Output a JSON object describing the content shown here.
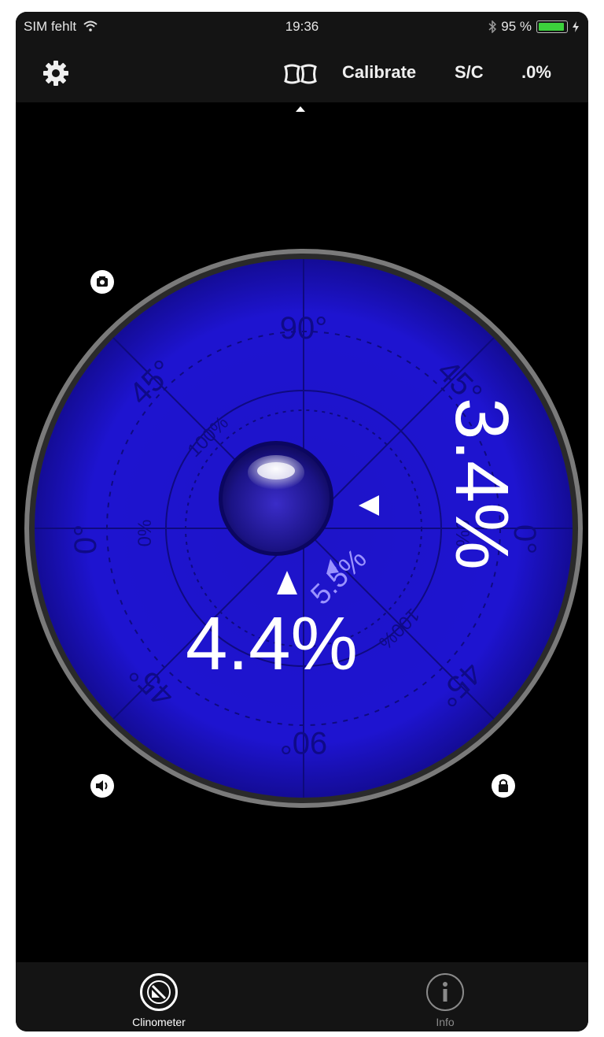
{
  "status": {
    "carrier": "SIM fehlt",
    "time": "19:36",
    "battery": "95 %",
    "battery_level": 0.95
  },
  "toolbar": {
    "calibrate": "Calibrate",
    "sc": "S/C",
    "percent": ".0%"
  },
  "dial": {
    "tick_top": "90°",
    "tick_top_left": "45°",
    "tick_top_right": "45°",
    "tick_left": "0°",
    "tick_right": "0°",
    "tick_bottom_left": "45°",
    "tick_bottom_right": "45°",
    "tick_bottom": "90°",
    "inner_100_left": "100%",
    "inner_0_left": "0%",
    "inner_0_right": "0%",
    "inner_100_right": "100%",
    "reading_x": "4.4%",
    "reading_y": "3.4%",
    "reading_total": "5.5%"
  },
  "tabs": {
    "clinometer": "Clinometer",
    "info": "Info"
  },
  "colors": {
    "dial_blue": "#1e14c8",
    "accent_green": "#3cd13c"
  }
}
